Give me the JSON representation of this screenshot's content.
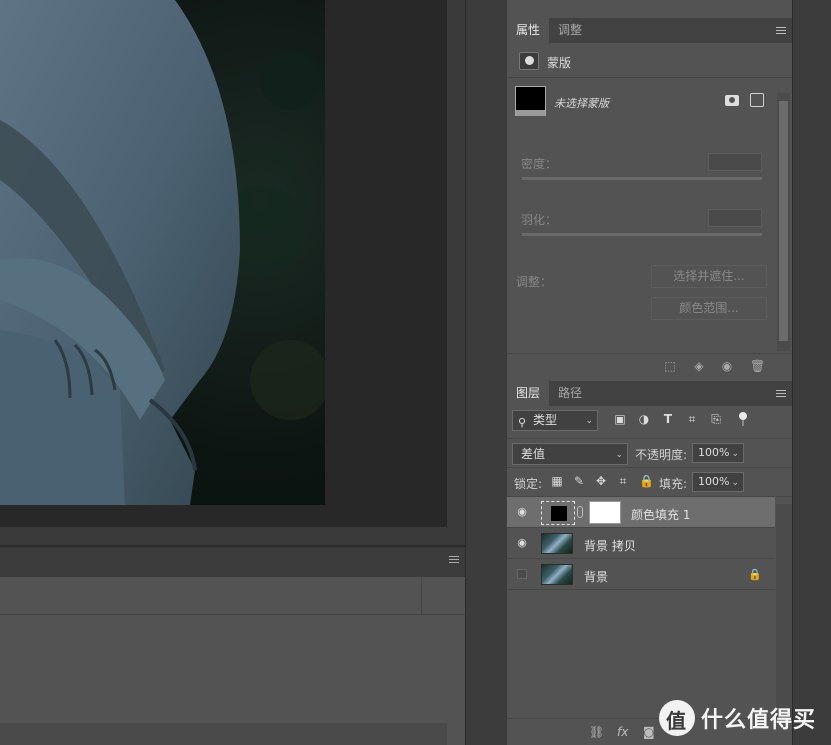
{
  "properties_panel": {
    "tabs": [
      {
        "label": "属性"
      },
      {
        "label": "调整"
      }
    ],
    "mask_header": "蒙版",
    "mask_desc": "未选择蒙版",
    "density_label": "密度：",
    "feather_label": "羽化：",
    "adjust_label": "调整：",
    "select_and_mask_btn": "选择并遮住...",
    "color_range_btn": "颜色范围..."
  },
  "layers_panel": {
    "tabs": [
      {
        "label": "图层"
      },
      {
        "label": "路径"
      }
    ],
    "filter_kind": "类型",
    "blend_mode": "差值",
    "opacity_label": "不透明度:",
    "opacity_value": "100%",
    "lock_label": "锁定:",
    "fill_label": "填充:",
    "fill_value": "100%",
    "layers": [
      {
        "name": "颜色填充 1",
        "visible": true,
        "selected": true,
        "type": "fill"
      },
      {
        "name": "背景 拷贝",
        "visible": true,
        "selected": false,
        "type": "photo"
      },
      {
        "name": "背景",
        "visible": false,
        "selected": false,
        "type": "photo",
        "locked": true
      }
    ]
  },
  "icons": {
    "filter_icons": [
      "image-filter-icon",
      "adjustment-filter-icon",
      "type-filter-icon",
      "shape-filter-icon",
      "smart-object-filter-icon"
    ],
    "lock_icons": [
      "lock-transparent-icon",
      "lock-paint-icon",
      "lock-position-icon",
      "lock-artboard-icon",
      "lock-all-icon"
    ],
    "footer_icons": [
      "link-icon",
      "fx-icon",
      "add-mask-icon",
      "adjustment-icon",
      "group-icon",
      "new-layer-icon",
      "trash-icon"
    ]
  },
  "watermark": {
    "logo_glyph": "值",
    "text": "什么值得买"
  }
}
